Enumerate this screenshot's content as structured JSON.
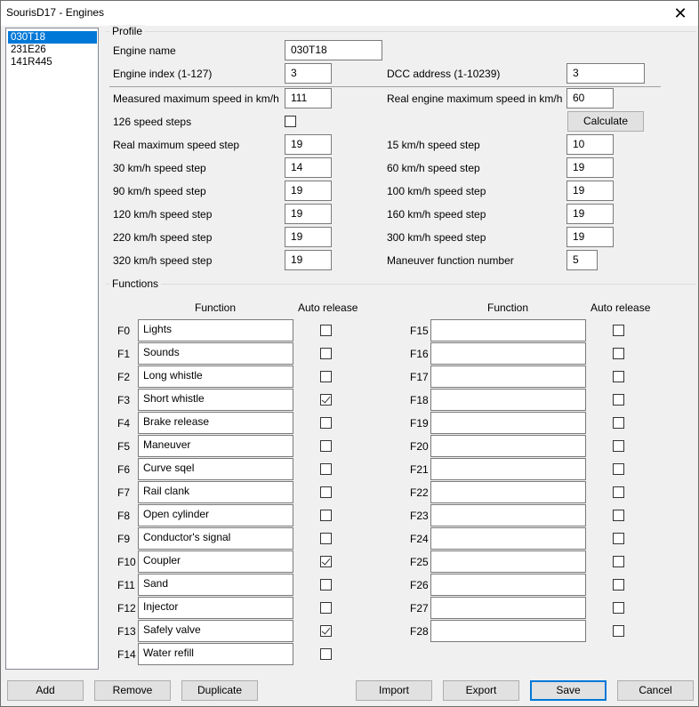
{
  "window": {
    "title": "SourisD17 - Engines",
    "close_glyph": "✕"
  },
  "engines": [
    "030T18",
    "231E26",
    "141R445"
  ],
  "profile": {
    "label": "Profile",
    "engine_name_label": "Engine name",
    "engine_name": "030T18",
    "engine_index_label": "Engine index (1-127)",
    "engine_index": "3",
    "dcc_address_label": "DCC address (1-10239)",
    "dcc_address": "3",
    "measured_max_speed_label": "Measured maximum speed in km/h",
    "measured_max_speed": "111",
    "real_max_speed_label": "Real engine maximum speed in km/h",
    "real_max_speed": "60",
    "speed_steps_126_label": "126 speed steps",
    "speed_steps_126_checked": false,
    "calculate_label": "Calculate",
    "real_max_speed_step_label": "Real maximum speed step",
    "real_max_speed_step": "19",
    "step_15_label": "15 km/h speed step",
    "step_15": "10",
    "step_30_label": "30 km/h speed step",
    "step_30": "14",
    "step_60_label": "60 km/h speed step",
    "step_60": "19",
    "step_90_label": "90 km/h speed step",
    "step_90": "19",
    "step_100_label": "100 km/h speed step",
    "step_100": "19",
    "step_120_label": "120 km/h speed step",
    "step_120": "19",
    "step_160_label": "160 km/h speed step",
    "step_160": "19",
    "step_220_label": "220 km/h speed step",
    "step_220": "19",
    "step_300_label": "300 km/h speed step",
    "step_300": "19",
    "step_320_label": "320 km/h speed step",
    "step_320": "19",
    "maneuver_fn_label": "Maneuver function number",
    "maneuver_fn": "5"
  },
  "functions": {
    "label": "Functions",
    "col_function": "Function",
    "col_auto_release": "Auto release",
    "items": [
      {
        "key": "F0",
        "name": "Lights",
        "auto": false
      },
      {
        "key": "F1",
        "name": "Sounds",
        "auto": false
      },
      {
        "key": "F2",
        "name": "Long whistle",
        "auto": false
      },
      {
        "key": "F3",
        "name": "Short whistle",
        "auto": true
      },
      {
        "key": "F4",
        "name": "Brake release",
        "auto": false
      },
      {
        "key": "F5",
        "name": "Maneuver",
        "auto": false
      },
      {
        "key": "F6",
        "name": "Curve sqel",
        "auto": false
      },
      {
        "key": "F7",
        "name": "Rail clank",
        "auto": false
      },
      {
        "key": "F8",
        "name": "Open cylinder",
        "auto": false
      },
      {
        "key": "F9",
        "name": "Conductor's signal",
        "auto": false
      },
      {
        "key": "F10",
        "name": "Coupler",
        "auto": true
      },
      {
        "key": "F11",
        "name": "Sand",
        "auto": false
      },
      {
        "key": "F12",
        "name": "Injector",
        "auto": false
      },
      {
        "key": "F13",
        "name": "Safely valve",
        "auto": true
      },
      {
        "key": "F14",
        "name": "Water refill",
        "auto": false
      },
      {
        "key": "F15",
        "name": "",
        "auto": false
      },
      {
        "key": "F16",
        "name": "",
        "auto": false
      },
      {
        "key": "F17",
        "name": "",
        "auto": false
      },
      {
        "key": "F18",
        "name": "",
        "auto": false
      },
      {
        "key": "F19",
        "name": "",
        "auto": false
      },
      {
        "key": "F20",
        "name": "",
        "auto": false
      },
      {
        "key": "F21",
        "name": "",
        "auto": false
      },
      {
        "key": "F22",
        "name": "",
        "auto": false
      },
      {
        "key": "F23",
        "name": "",
        "auto": false
      },
      {
        "key": "F24",
        "name": "",
        "auto": false
      },
      {
        "key": "F25",
        "name": "",
        "auto": false
      },
      {
        "key": "F26",
        "name": "",
        "auto": false
      },
      {
        "key": "F27",
        "name": "",
        "auto": false
      },
      {
        "key": "F28",
        "name": "",
        "auto": false
      }
    ]
  },
  "buttons": {
    "add": "Add",
    "remove": "Remove",
    "duplicate": "Duplicate",
    "import": "Import",
    "export": "Export",
    "save": "Save",
    "cancel": "Cancel"
  },
  "colors": {
    "selection": "#0078d7",
    "default_button_border": "#0078d7"
  }
}
